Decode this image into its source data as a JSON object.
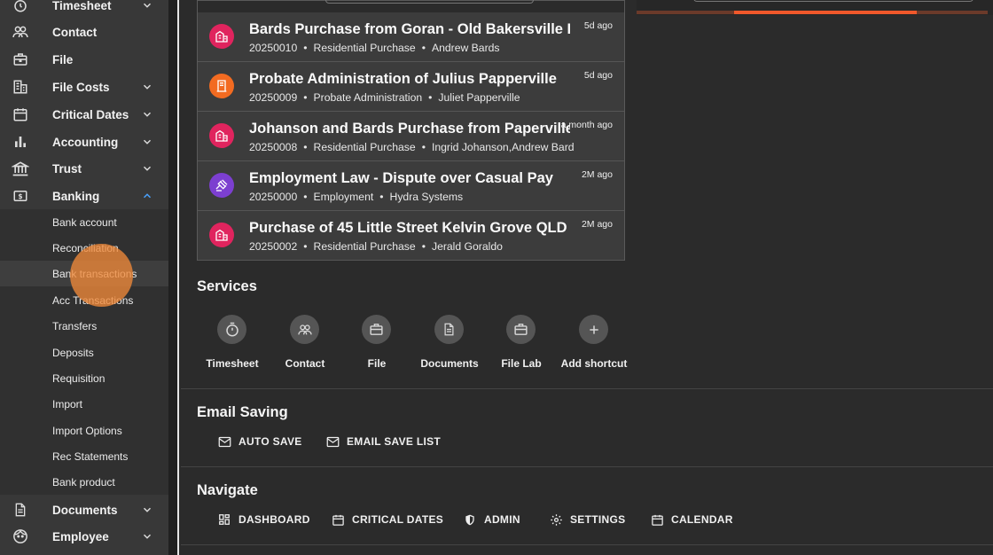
{
  "colors": {
    "accent": "#f0582b",
    "click_indicator": "#ef893a",
    "residential_icon_bg": "#e0245e",
    "probate_icon_bg": "#f26b21",
    "employment_icon_bg": "#7c3fd0"
  },
  "sidebar": {
    "items": [
      {
        "label": "Timesheet",
        "icon": "stopwatch-icon",
        "expandable": true
      },
      {
        "label": "Contact",
        "icon": "people-icon",
        "expandable": false
      },
      {
        "label": "File",
        "icon": "briefcase-icon",
        "expandable": false
      },
      {
        "label": "File Costs",
        "icon": "building-icon",
        "expandable": true
      },
      {
        "label": "Critical Dates",
        "icon": "calendar-icon",
        "expandable": true
      },
      {
        "label": "Accounting",
        "icon": "bar-chart-icon",
        "expandable": true
      },
      {
        "label": "Trust",
        "icon": "bank-icon",
        "expandable": true
      },
      {
        "label": "Banking",
        "icon": "dollar-bill-icon",
        "expandable": true,
        "expanded": true
      }
    ],
    "banking_submenu": [
      "Bank account",
      "Reconciliation",
      "Bank transactions",
      "Acc Transactions",
      "Transfers",
      "Deposits",
      "Requisition",
      "Import",
      "Import Options",
      "Rec Statements",
      "Bank product"
    ],
    "active_submenu": "Bank transactions",
    "bottom_items": [
      {
        "label": "Documents",
        "icon": "document-icon",
        "expandable": true
      },
      {
        "label": "Employee",
        "icon": "face-icon",
        "expandable": true
      }
    ]
  },
  "files": [
    {
      "title": "Bards Purchase from Goran - Old Bakersville Hou",
      "number": "20250010",
      "type": "Residential Purchase",
      "client": "Andrew Bards",
      "time": "5d ago",
      "icon": "residential-icon"
    },
    {
      "title": "Probate Administration of Julius Papperville",
      "number": "20250009",
      "type": "Probate Administration",
      "client": "Juliet Papperville",
      "time": "5d ago",
      "icon": "probate-icon"
    },
    {
      "title": "Johanson and Bards Purchase from Paperville",
      "number": "20250008",
      "type": "Residential Purchase",
      "client": "Ingrid Johanson,Andrew Bard",
      "time": "a month ago",
      "icon": "residential-icon"
    },
    {
      "title": "Employment Law - Dispute over Casual Pay",
      "number": "20250000",
      "type": "Employment",
      "client": "Hydra Systems",
      "time": "2M ago",
      "icon": "gavel-icon"
    },
    {
      "title": "Purchase of 45 Little Street Kelvin Grove QLD",
      "number": "20250002",
      "type": "Residential Purchase",
      "client": "Jerald Goraldo",
      "time": "2M ago",
      "icon": "residential-icon"
    }
  ],
  "right_panel": {
    "progress": 0.72
  },
  "services": {
    "title": "Services",
    "shortcuts": [
      {
        "label": "Timesheet",
        "icon": "stopwatch-icon"
      },
      {
        "label": "Contact",
        "icon": "people-icon"
      },
      {
        "label": "File",
        "icon": "briefcase-icon"
      },
      {
        "label": "Documents",
        "icon": "document-icon"
      },
      {
        "label": "File Lab",
        "icon": "briefcase-icon"
      },
      {
        "label": "Add shortcut",
        "icon": "plus-icon"
      }
    ]
  },
  "email_saving": {
    "title": "Email Saving",
    "buttons": [
      {
        "label": "AUTO SAVE",
        "icon": "mail-icon"
      },
      {
        "label": "EMAIL SAVE LIST",
        "icon": "mail-icon"
      }
    ]
  },
  "navigate": {
    "title": "Navigate",
    "buttons": [
      {
        "label": "DASHBOARD",
        "icon": "dashboard-icon"
      },
      {
        "label": "CRITICAL DATES",
        "icon": "calendar-icon"
      },
      {
        "label": "ADMIN",
        "icon": "shield-icon"
      },
      {
        "label": "SETTINGS",
        "icon": "gear-icon"
      },
      {
        "label": "CALENDAR",
        "icon": "calendar-icon"
      }
    ]
  }
}
